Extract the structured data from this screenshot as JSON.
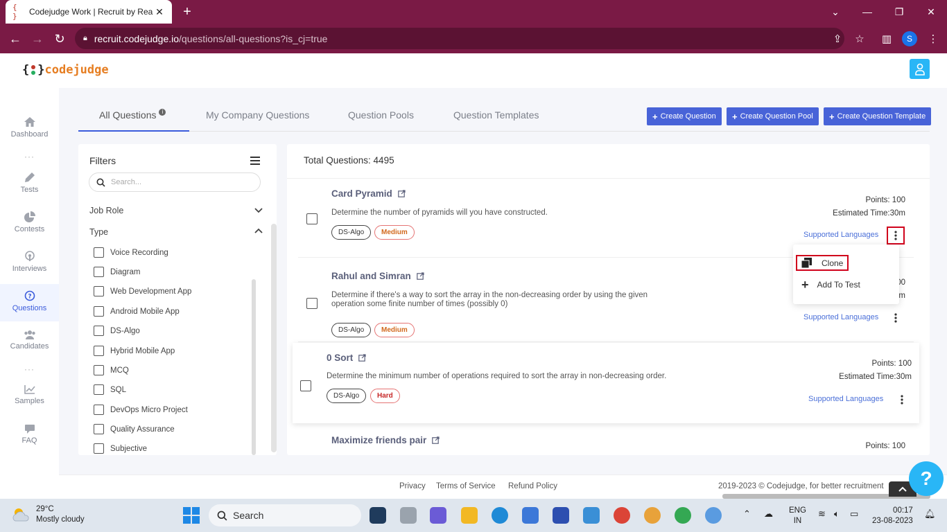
{
  "browser": {
    "tab_title": "Codejudge Work | Recruit by Rea",
    "favicon_text": "{ }",
    "url_host": "recruit.codejudge.io",
    "url_path": "/questions/all-questions?is_cj=true",
    "profile_letter": "S"
  },
  "app": {
    "logo_open": "{",
    "logo_close": "}",
    "logo_text": "codejudge",
    "logo_dot_colors": [
      "#c0392b",
      "#27ae60"
    ]
  },
  "sidebar": {
    "items": [
      {
        "label": "Dashboard",
        "icon": "home-icon"
      },
      {
        "label": "Tests",
        "icon": "pencil-icon"
      },
      {
        "label": "Contests",
        "icon": "pie-chart-icon"
      },
      {
        "label": "Interviews",
        "icon": "podcast-icon"
      },
      {
        "label": "Questions",
        "icon": "question-circle-icon",
        "active": true
      },
      {
        "label": "Candidates",
        "icon": "users-icon"
      },
      {
        "label": "Samples",
        "icon": "line-chart-icon"
      },
      {
        "label": "FAQ",
        "icon": "chat-icon"
      }
    ],
    "separator": "···"
  },
  "tabs": [
    {
      "label": "All Questions",
      "active": true,
      "info": "i"
    },
    {
      "label": "My Company Questions"
    },
    {
      "label": "Question Pools"
    },
    {
      "label": "Question Templates"
    }
  ],
  "actions": {
    "create_question": "Create Question",
    "create_pool": "Create Question Pool",
    "create_template": "Create Question Template",
    "plus": "+"
  },
  "filters": {
    "title": "Filters",
    "search_placeholder": "Search...",
    "job_role": "Job Role",
    "type": "Type",
    "options": [
      "Voice Recording",
      "Diagram",
      "Web Development App",
      "Android Mobile App",
      "DS-Algo",
      "Hybrid Mobile App",
      "MCQ",
      "SQL",
      "DevOps Micro Project",
      "Quality Assurance",
      "Subjective"
    ]
  },
  "questions": {
    "total": "Total Questions: 4495",
    "supported_languages": "Supported Languages",
    "items": [
      {
        "title": "Card Pyramid",
        "desc": "Determine the number of pyramids will you have constructed.",
        "tags": [
          "DS-Algo",
          "Medium"
        ],
        "points": "Points: 100",
        "time": "Estimated Time:30m"
      },
      {
        "title": "Rahul and Simran",
        "desc": "Determine if there's a way to sort the array in the non-decreasing order by using the given operation some finite number of times (possibly 0)",
        "tags": [
          "DS-Algo",
          "Medium"
        ],
        "points_partial": "00",
        "time_partial": "m"
      },
      {
        "title": "0 Sort",
        "desc": "Determine the minimum number of operations required to sort the array in non-decreasing order.",
        "tags": [
          "DS-Algo",
          "Hard"
        ],
        "points": "Points: 100",
        "time": "Estimated Time:30m"
      },
      {
        "title": "Maximize friends pair",
        "points": "Points: 100"
      }
    ]
  },
  "menu": {
    "clone": "Clone",
    "add_to_test": "Add To Test",
    "plus": "+"
  },
  "footer": {
    "privacy": "Privacy",
    "terms": "Terms of Service",
    "refund": "Refund Policy",
    "copyright": "2019-2023 ©  Codejudge, for better recruitment"
  },
  "help": {
    "label": "?"
  },
  "taskbar": {
    "temp": "29°C",
    "weather": "Mostly cloudy",
    "search": "Search",
    "lang1": "ENG",
    "lang2": "IN",
    "time": "00:17",
    "date": "23-08-2023"
  }
}
